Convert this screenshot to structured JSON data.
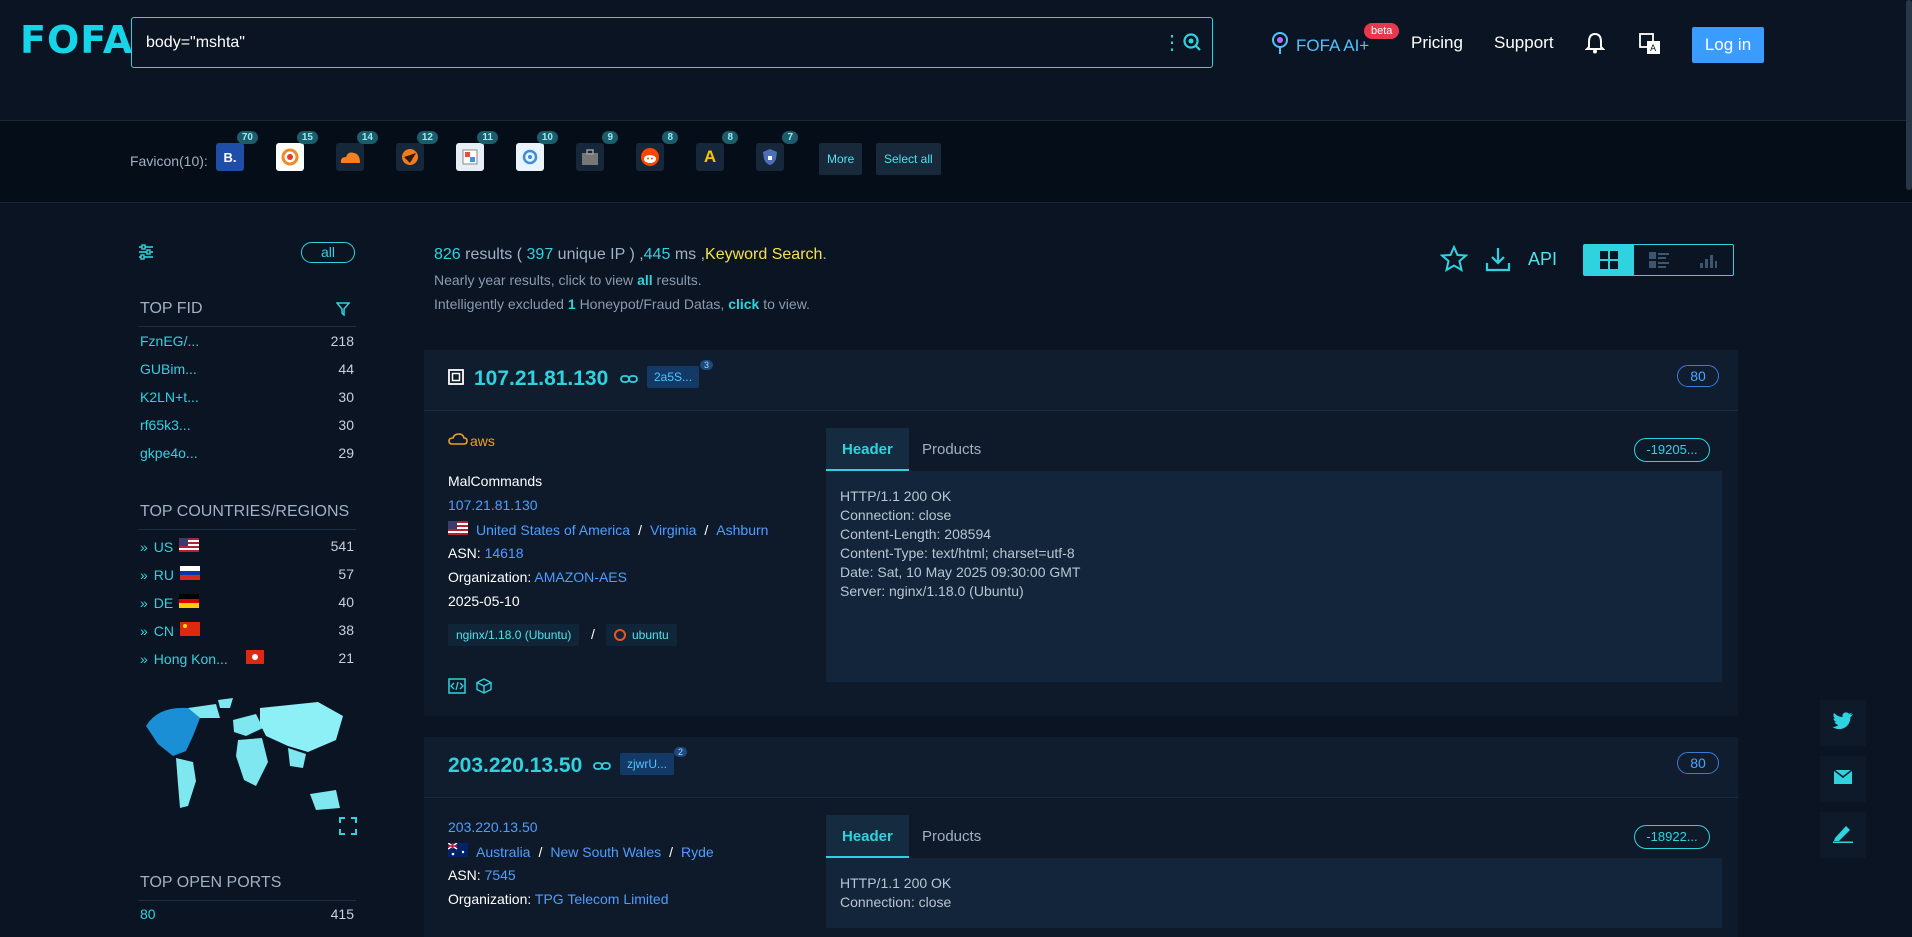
{
  "header": {
    "logo": "FOFA",
    "search_value": "body=\"mshta\"",
    "ai_label": "FOFA AI+",
    "beta_badge": "beta",
    "nav": [
      "Pricing",
      "Support"
    ],
    "login_label": "Log in"
  },
  "favicons": {
    "label": "Favicon(10):",
    "items": [
      {
        "icon": "booking-b-icon",
        "glyph": "B.",
        "count": "70"
      },
      {
        "icon": "spiral-logo-icon",
        "glyph": "",
        "count": "15"
      },
      {
        "icon": "cloudflare-icon",
        "glyph": "",
        "count": "14"
      },
      {
        "icon": "orange-disc-icon",
        "glyph": "",
        "count": "12"
      },
      {
        "icon": "image-preview-icon",
        "glyph": "",
        "count": "11"
      },
      {
        "icon": "bluebird-icon",
        "glyph": "",
        "count": "10"
      },
      {
        "icon": "briefcase-icon",
        "glyph": "",
        "count": "9"
      },
      {
        "icon": "reddit-icon",
        "glyph": "",
        "count": "8"
      },
      {
        "icon": "yellow-a-icon",
        "glyph": "A",
        "count": "8"
      },
      {
        "icon": "shield-lock-icon",
        "glyph": "",
        "count": "7"
      }
    ],
    "more_label": "More",
    "select_all_label": "Select all"
  },
  "sidebar": {
    "all_label": "all",
    "top_fid": {
      "title": "TOP FID",
      "rows": [
        {
          "label": "FznEG/...",
          "count": "218"
        },
        {
          "label": "GUBim...",
          "count": "44"
        },
        {
          "label": "K2LN+t...",
          "count": "30"
        },
        {
          "label": "rf65k3...",
          "count": "30"
        },
        {
          "label": "gkpe4o...",
          "count": "29"
        }
      ]
    },
    "top_countries": {
      "title": "TOP COUNTRIES/REGIONS",
      "rows": [
        {
          "label": "US",
          "count": "541",
          "flag": "us"
        },
        {
          "label": "RU",
          "count": "57",
          "flag": "ru"
        },
        {
          "label": "DE",
          "count": "40",
          "flag": "de"
        },
        {
          "label": "CN",
          "count": "38",
          "flag": "cn"
        },
        {
          "label": "Hong Kon...",
          "count": "21",
          "flag": "hk"
        }
      ]
    },
    "top_ports": {
      "title": "TOP OPEN PORTS",
      "rows": [
        {
          "label": "80",
          "count": "415"
        }
      ]
    }
  },
  "summary": {
    "results_count": "826",
    "results_word": "results (",
    "unique_ip": "397",
    "unique_word": "unique IP ) ,",
    "ms": "445",
    "ms_word": "ms ,",
    "keyword": "Keyword Search",
    "period": ".",
    "line2_pre": "Nearly year results, click to view",
    "line2_link": "all",
    "line2_post": "results.",
    "line3_pre": "Intelligently excluded",
    "line3_num": "1",
    "line3_mid": "Honeypot/Fraud Datas,",
    "line3_link": "click",
    "line3_post": "to view.",
    "api_label": "API"
  },
  "results": [
    {
      "ip": "107.21.81.130",
      "tag": "2a5S...",
      "tag_count": "3",
      "port": "80",
      "cloud": "aws",
      "title": "MalCommands",
      "ip_link": "107.21.81.130",
      "country": "United States of America",
      "region": "Virginia",
      "city": "Ashburn",
      "asn_label": "ASN:",
      "asn": "14618",
      "org_label": "Organization:",
      "org": "AMAZON-AES",
      "date": "2025-05-10",
      "server_chip": "nginx/1.18.0 (Ubuntu)",
      "os_chip": "ubuntu",
      "tab_header": "Header",
      "tab_products": "Products",
      "hash": "-19205...",
      "header_text": "HTTP/1.1 200 OK\nConnection: close\nContent-Length: 208594\nContent-Type: text/html; charset=utf-8\nDate: Sat, 10 May 2025 09:30:00 GMT\nServer: nginx/1.18.0 (Ubuntu)"
    },
    {
      "ip": "203.220.13.50",
      "tag": "zjwrU...",
      "tag_count": "2",
      "port": "80",
      "ip_link": "203.220.13.50",
      "country": "Australia",
      "region": "New South Wales",
      "city": "Ryde",
      "asn_label": "ASN:",
      "asn": "7545",
      "org_label": "Organization:",
      "org": "TPG Telecom Limited",
      "tab_header": "Header",
      "tab_products": "Products",
      "hash": "-18922...",
      "header_text": "HTTP/1.1 200 OK\nConnection: close"
    }
  ],
  "colors": {
    "accent": "#2fd3df",
    "link": "#4f9dff",
    "keyword": "#f5e24a",
    "login": "#3b9cff",
    "bg": "#0b1422"
  }
}
